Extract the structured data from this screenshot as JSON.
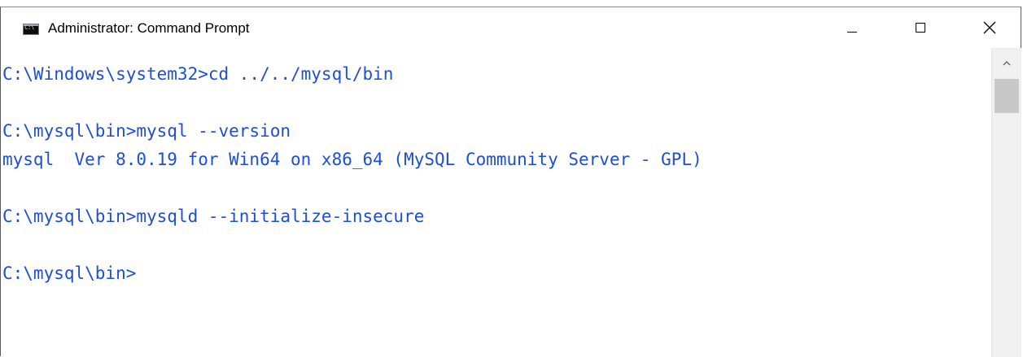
{
  "window": {
    "title": "Administrator: Command Prompt",
    "icon": "cmd-icon",
    "controls": {
      "minimize": "minimize-icon",
      "maximize": "maximize-icon",
      "close": "close-icon"
    }
  },
  "console": {
    "lines": [
      "C:\\Windows\\system32>cd ../../mysql/bin",
      "",
      "C:\\mysql\\bin>mysql --version",
      "mysql  Ver 8.0.19 for Win64 on x86_64 (MySQL Community Server - GPL)",
      "",
      "C:\\mysql\\bin>mysqld --initialize-insecure",
      "",
      "C:\\mysql\\bin>"
    ],
    "text_color": "#1d4ed8",
    "background": "#ffffff"
  },
  "scrollbar": {
    "up_arrow": "chevron-up-icon"
  }
}
